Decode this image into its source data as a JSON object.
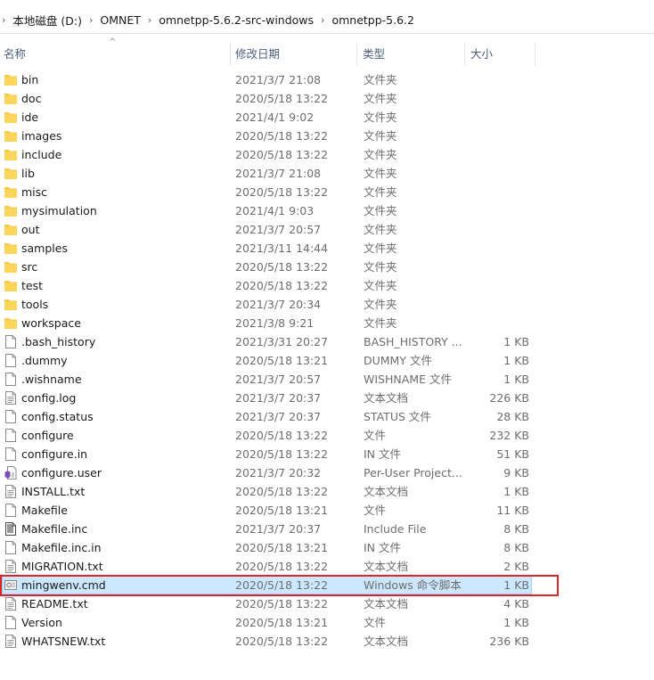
{
  "breadcrumb": [
    "本地磁盘 (D:)",
    "OMNET",
    "omnetpp-5.6.2-src-windows",
    "omnetpp-5.6.2"
  ],
  "columns": {
    "name": "名称",
    "date": "修改日期",
    "type": "类型",
    "size": "大小"
  },
  "files": [
    {
      "name": "bin",
      "date": "2021/3/7 21:08",
      "type": "文件夹",
      "size": "",
      "icon": "folder-icon"
    },
    {
      "name": "doc",
      "date": "2020/5/18 13:22",
      "type": "文件夹",
      "size": "",
      "icon": "folder-icon"
    },
    {
      "name": "ide",
      "date": "2021/4/1 9:02",
      "type": "文件夹",
      "size": "",
      "icon": "folder-icon"
    },
    {
      "name": "images",
      "date": "2020/5/18 13:22",
      "type": "文件夹",
      "size": "",
      "icon": "folder-icon"
    },
    {
      "name": "include",
      "date": "2020/5/18 13:22",
      "type": "文件夹",
      "size": "",
      "icon": "folder-icon"
    },
    {
      "name": "lib",
      "date": "2021/3/7 21:08",
      "type": "文件夹",
      "size": "",
      "icon": "folder-icon"
    },
    {
      "name": "misc",
      "date": "2020/5/18 13:22",
      "type": "文件夹",
      "size": "",
      "icon": "folder-icon"
    },
    {
      "name": "mysimulation",
      "date": "2021/4/1 9:03",
      "type": "文件夹",
      "size": "",
      "icon": "folder-icon"
    },
    {
      "name": "out",
      "date": "2021/3/7 20:57",
      "type": "文件夹",
      "size": "",
      "icon": "folder-icon"
    },
    {
      "name": "samples",
      "date": "2021/3/11 14:44",
      "type": "文件夹",
      "size": "",
      "icon": "folder-icon"
    },
    {
      "name": "src",
      "date": "2020/5/18 13:22",
      "type": "文件夹",
      "size": "",
      "icon": "folder-icon"
    },
    {
      "name": "test",
      "date": "2020/5/18 13:22",
      "type": "文件夹",
      "size": "",
      "icon": "folder-icon"
    },
    {
      "name": "tools",
      "date": "2021/3/7 20:34",
      "type": "文件夹",
      "size": "",
      "icon": "folder-icon"
    },
    {
      "name": "workspace",
      "date": "2021/3/8 9:21",
      "type": "文件夹",
      "size": "",
      "icon": "folder-icon"
    },
    {
      "name": ".bash_history",
      "date": "2021/3/31 20:27",
      "type": "BASH_HISTORY ...",
      "size": "1 KB",
      "icon": "file-icon"
    },
    {
      "name": ".dummy",
      "date": "2020/5/18 13:21",
      "type": "DUMMY 文件",
      "size": "1 KB",
      "icon": "file-icon"
    },
    {
      "name": ".wishname",
      "date": "2021/3/7 20:57",
      "type": "WISHNAME 文件",
      "size": "1 KB",
      "icon": "file-icon"
    },
    {
      "name": "config.log",
      "date": "2021/3/7 20:37",
      "type": "文本文档",
      "size": "226 KB",
      "icon": "text-file-icon"
    },
    {
      "name": "config.status",
      "date": "2021/3/7 20:37",
      "type": "STATUS 文件",
      "size": "28 KB",
      "icon": "file-icon"
    },
    {
      "name": "configure",
      "date": "2020/5/18 13:22",
      "type": "文件",
      "size": "232 KB",
      "icon": "file-icon"
    },
    {
      "name": "configure.in",
      "date": "2020/5/18 13:22",
      "type": "IN 文件",
      "size": "51 KB",
      "icon": "file-icon"
    },
    {
      "name": "configure.user",
      "date": "2021/3/7 20:32",
      "type": "Per-User Project...",
      "size": "9 KB",
      "icon": "project-file-icon"
    },
    {
      "name": "INSTALL.txt",
      "date": "2020/5/18 13:22",
      "type": "文本文档",
      "size": "1 KB",
      "icon": "text-file-icon"
    },
    {
      "name": "Makefile",
      "date": "2020/5/18 13:21",
      "type": "文件",
      "size": "11 KB",
      "icon": "file-icon"
    },
    {
      "name": "Makefile.inc",
      "date": "2021/3/7 20:37",
      "type": "Include File",
      "size": "8 KB",
      "icon": "include-file-icon"
    },
    {
      "name": "Makefile.inc.in",
      "date": "2020/5/18 13:21",
      "type": "IN 文件",
      "size": "8 KB",
      "icon": "file-icon"
    },
    {
      "name": "MIGRATION.txt",
      "date": "2020/5/18 13:22",
      "type": "文本文档",
      "size": "2 KB",
      "icon": "text-file-icon"
    },
    {
      "name": "mingwenv.cmd",
      "date": "2020/5/18 13:22",
      "type": "Windows 命令脚本",
      "size": "1 KB",
      "icon": "cmd-file-icon",
      "selected": true
    },
    {
      "name": "README.txt",
      "date": "2020/5/18 13:22",
      "type": "文本文档",
      "size": "4 KB",
      "icon": "text-file-icon"
    },
    {
      "name": "Version",
      "date": "2020/5/18 13:21",
      "type": "文件",
      "size": "1 KB",
      "icon": "file-icon"
    },
    {
      "name": "WHATSNEW.txt",
      "date": "2020/5/18 13:22",
      "type": "文本文档",
      "size": "236 KB",
      "icon": "text-file-icon"
    }
  ],
  "colors": {
    "selection": "#cce8ff",
    "selection_border": "#99d1ff",
    "highlight": "#e0242c",
    "folder": "#f7c948"
  }
}
